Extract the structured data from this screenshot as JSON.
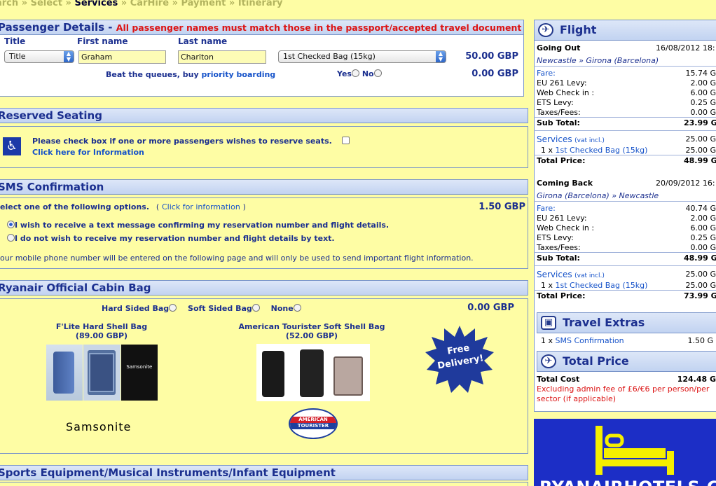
{
  "breadcrumb": {
    "items": [
      "arch",
      "Select",
      "Services",
      "CarHire",
      "Payment",
      "Itinerary"
    ],
    "current": "Services",
    "separator": "»"
  },
  "passenger": {
    "title": "Passenger Details -",
    "warning": "All passenger names must match those in the passport/accepted travel document",
    "col_title": "Title",
    "col_first": "First name",
    "col_last": "Last name",
    "title_value": "Title",
    "first_value": "Graham",
    "last_value": "Charlton",
    "bag_value": "1st Checked Bag (15kg)",
    "bag_price": "50.00 GBP",
    "priority_text": "Beat the queues, buy",
    "priority_link": "priority boarding",
    "yes": "Yes",
    "no": "No",
    "priority_price": "0.00 GBP"
  },
  "seating": {
    "title": "Reserved Seating",
    "text": "Please check box if one or more passengers wishes to reserve seats.",
    "link": "Click here for Information"
  },
  "sms": {
    "title": "SMS Confirmation",
    "prompt": "elect one of the following options.",
    "link_open": "(",
    "link": "Click for information",
    "link_close": ")",
    "price": "1.50  GBP",
    "option1": "I wish to receive a text message confirming my reservation number and flight details.",
    "option2": "I do not wish to receive my reservation number and flight details by text.",
    "note": "our mobile phone number will be entered on the following page and will only be used to send important flight information."
  },
  "cabin": {
    "title": "Ryanair Official Cabin Bag",
    "hard": "Hard Sided Bag",
    "soft": "Soft Sided Bag",
    "none": "None",
    "price": "0.00 GBP",
    "bag1_name": "F'Lite Hard Shell Bag",
    "bag1_price": "(89.00 GBP)",
    "bag2_name": "American Tourister Soft Shell Bag",
    "bag2_price": "(52.00 GBP)",
    "samsonite_logo": "Samsonite",
    "samsonite_label": "Samsonite",
    "at_logo_1": "AMERICAN",
    "at_logo_2": "TOURISTER",
    "free_1": "Free",
    "free_2": "Delivery!"
  },
  "sports": {
    "title": "Sports Equipment/Musical Instruments/Infant Equipment"
  },
  "summary": {
    "flight_title": "Flight",
    "out": {
      "label": "Going Out",
      "date": "16/08/2012 18:",
      "route": "Newcastle » Girona (Barcelona)",
      "fare_label": "Fare:",
      "fare": "15.74 G",
      "eu_label": "EU 261 Levy:",
      "eu": "2.00 G",
      "web_label": "Web Check in :",
      "web": "6.00 G",
      "ets_label": "ETS Levy:",
      "ets": "0.25 G",
      "tax_label": "Taxes/Fees:",
      "tax": "0.00 G",
      "sub_label": "Sub Total:",
      "sub": "23.99 G",
      "svc_label": "Services",
      "svc_note": "(vat incl.)",
      "svc": "25.00 G",
      "bag_qty": "1 x",
      "bag_label": "1st Checked Bag (15kg)",
      "bag": "25.00 G",
      "total_label": "Total Price:",
      "total": "48.99 G"
    },
    "back": {
      "label": "Coming Back",
      "date": "20/09/2012 16:",
      "route": "Girona (Barcelona) » Newcastle",
      "fare_label": "Fare:",
      "fare": "40.74 G",
      "eu_label": "EU 261 Levy:",
      "eu": "2.00 G",
      "web_label": "Web Check in :",
      "web": "6.00 G",
      "ets_label": "ETS Levy:",
      "ets": "0.25 G",
      "tax_label": "Taxes/Fees:",
      "tax": "0.00 G",
      "sub_label": "Sub Total:",
      "sub": "48.99 G",
      "svc_label": "Services",
      "svc_note": "(vat incl.)",
      "svc": "25.00 G",
      "bag_qty": "1 x",
      "bag_label": "1st Checked Bag (15kg)",
      "bag": "25.00 G",
      "total_label": "Total Price:",
      "total": "73.99 G"
    },
    "extras_title": "Travel Extras",
    "extras_qty": "1 x",
    "extras_label": "SMS Confirmation",
    "extras_price": "1.50 G",
    "total_title": "Total Price",
    "total_label": "Total Cost",
    "total_value": "124.48 G",
    "admin_note": "Excluding admin fee of £6/€6 per person/per sector (if applicable)"
  },
  "hotels_banner": {
    "text": "RYANAIRHOTELS.COM"
  },
  "colors": {
    "page_bg": "#fefda4",
    "header_blue": "#1b2f8f",
    "link_blue": "#1552c9",
    "warning_red": "#dc1414",
    "banner_blue": "#1c2ec6",
    "banner_yellow": "#f5ef00"
  }
}
